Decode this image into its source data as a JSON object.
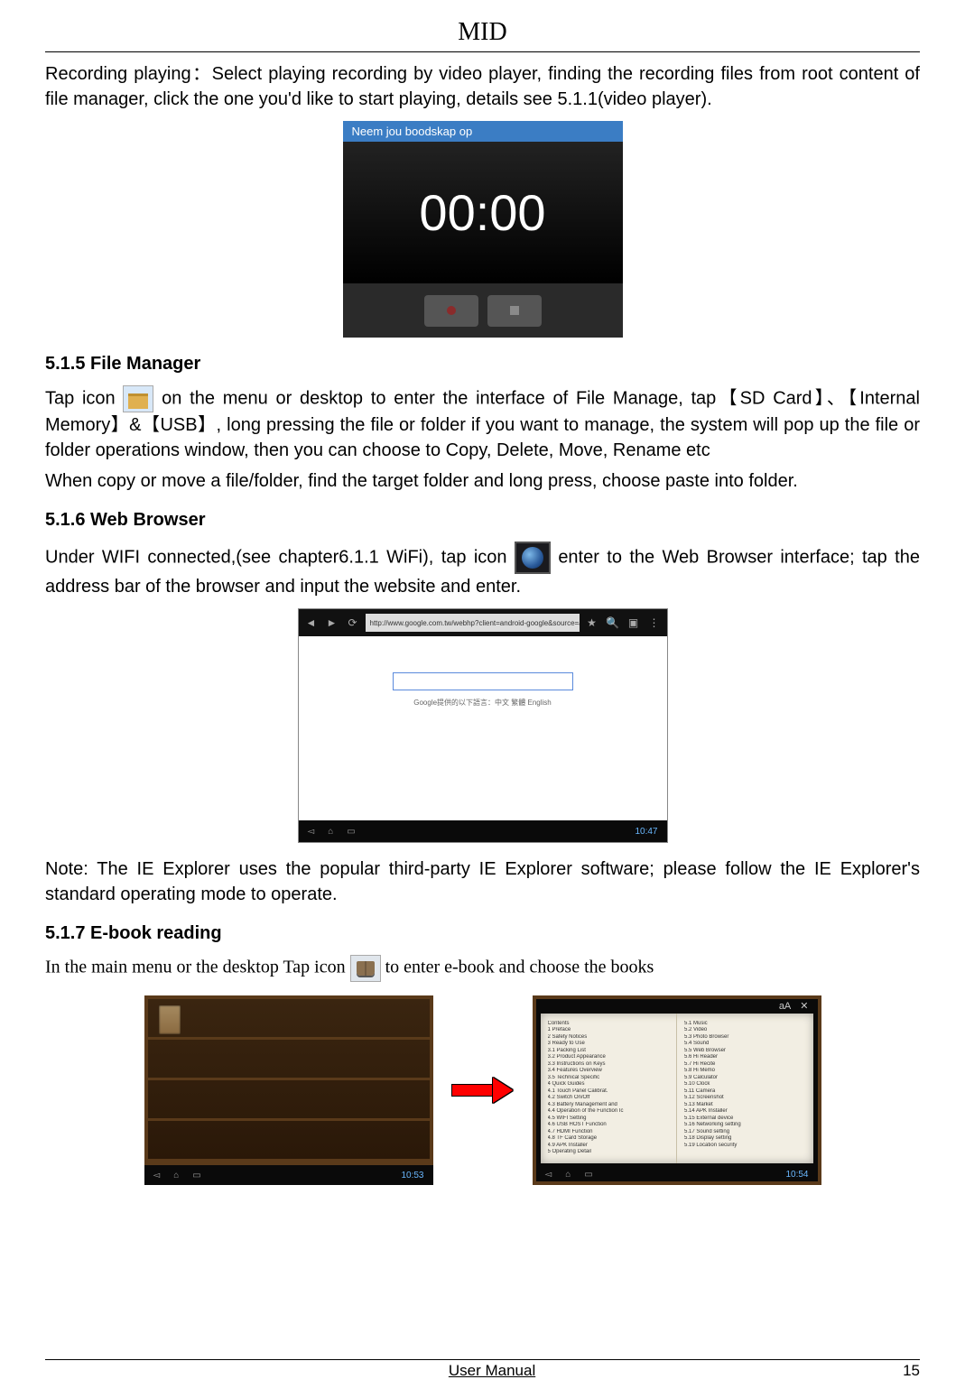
{
  "header": {
    "title": "MID"
  },
  "intro": {
    "text": "Recording playing：Select playing recording by video player, finding the recording files from root content of file manager, click the one you'd like to start playing, details see 5.1.1(video player)."
  },
  "recording_screenshot": {
    "title": "Neem jou boodskap op",
    "time": "00:00"
  },
  "section_515": {
    "heading": "5.1.5 File Manager",
    "pre_icon": "Tap icon ",
    "post_icon": "on the menu or desktop to enter the interface of File Manage, tap【SD Card】、【Internal Memory】&【USB】, long pressing the file or folder if you want to manage, the system will pop up the file or folder operations window, then you can choose to Copy, Delete, Move, Rename etc",
    "line2": "When copy or move a file/folder, find the target folder and long press, choose paste into folder."
  },
  "section_516": {
    "heading": "5.1.6 Web Browser",
    "pre_icon": "Under WIFI connected,(see chapter6.1.1 WiFi), tap icon",
    "post_icon": " enter to the Web Browser interface; tap the address bar of the browser and input the website and enter.",
    "note": "Note: The IE Explorer uses the popular third-party IE Explorer software; please follow the IE Explorer's standard operating mode to operate."
  },
  "browser_screenshot": {
    "url": "http://www.google.com.tw/webhp?client=android-google&source=android-home",
    "caption": "Google提供的以下語言：中文 繁體 English",
    "time": "10:47"
  },
  "section_517": {
    "heading": "5.1.7 E-book reading",
    "pre_icon": "In the main menu or the desktop Tap icon ",
    "post_icon": "to enter e-book and choose the books"
  },
  "ebook_shelf": {
    "time": "10:53"
  },
  "ebook_page": {
    "head_right": "aA ✕",
    "toc": [
      "Contents",
      "1 Preface",
      "2 Safety Notices",
      "3 Ready to Use",
      "3.1 Packing List",
      "3.2 Product Appearance",
      "3.3 Instructions on Keys",
      "3.4 Features Overview",
      "3.5 Technical Specific",
      "4 Quick Guides",
      "4.1 Touch Panel Calibrat.",
      "4.2 Switch On/Off",
      "4.3 Battery Management and",
      "4.4 Operation of the Function Ic",
      "4.5 WIFI Setting",
      "4.6 USB HOST Function",
      "4.7 HDMI Function",
      "4.8 TF Card Storage",
      "4.9 APK Installer",
      "5 Operating Detail"
    ],
    "right_col": [
      "5.1 Music",
      "5.2 Video",
      "5.3 Photo Browser",
      "5.4 Sound",
      "5.5 Web Browser",
      "5.6 Hi Reader",
      "5.7 Hi Recite",
      "5.8 Hi Memo",
      "5.9 Calculator",
      "5.10 Clock",
      "5.11 Camera",
      "5.12 Screenshot",
      "5.13 Market",
      "5.14 APK Installer",
      "5.15 External device",
      "5.16 Networking setting",
      "5.17 Sound setting",
      "5.18 Display setting",
      "5.19 Location security"
    ],
    "time": "10:54"
  },
  "footer": {
    "center": "User Manual",
    "page": "15"
  }
}
